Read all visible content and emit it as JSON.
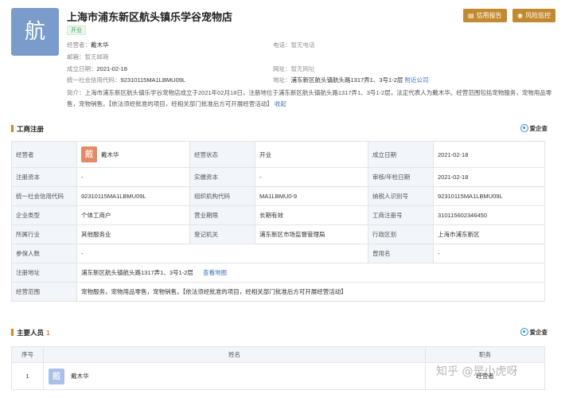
{
  "company": {
    "logo_char": "航",
    "name": "上海市浦东新区航头镇乐学谷宠物店",
    "status_tag": "开业"
  },
  "header_buttons": {
    "credit_report": "信用报告",
    "risk_monitor": "风险监控"
  },
  "info": {
    "operator_label": "经营者：",
    "operator_value": "戴木华",
    "phone_label": "电话：",
    "phone_value": "暂无电话",
    "email_label": "邮箱：",
    "email_value": "暂无邮箱",
    "founded_label": "成立日期：",
    "founded_value": "2021-02-18",
    "website_label": "网址：",
    "website_value": "暂无网址",
    "credit_code_label": "统一社会信用代码：",
    "credit_code_value": "92310115MA1LBMU09L",
    "address_label": "地址：",
    "address_value": "浦东新区航头镇航头路1317弄1、3号1-2层",
    "nearby_link": "附近公司",
    "intro_label": "简介：",
    "intro_text": "上海市浦东新区航头镇乐学谷宠物店成立于2021年02月18日，注册地位于浦东新区航头镇航头路1317弄1、3号1-2层，法定代表人为戴木华。经营范围包括宠物服务，宠物用品零售，宠物销售。【依法须经批准的项目，经相关部门批准后方可开展经营活动】",
    "collapse_link": "收起"
  },
  "registration": {
    "section_title": "工商注册",
    "qcc_label": "爱企查",
    "operator_avatar": "戴",
    "rows": [
      [
        {
          "k": "经营者",
          "v": "戴木华"
        },
        {
          "k": "经营状态",
          "v": "开业"
        },
        {
          "k": "成立日期",
          "v": "2021-02-18"
        }
      ],
      [
        {
          "k": "注册资本",
          "v": "-"
        },
        {
          "k": "实缴资本",
          "v": "-"
        },
        {
          "k": "审核/年检日期",
          "v": "2021-02-18"
        }
      ],
      [
        {
          "k": "统一社会信用代码",
          "v": "92310115MA1LBMU09L"
        },
        {
          "k": "组织机构代码",
          "v": "MA1LBMU0-9"
        },
        {
          "k": "纳税人识别号",
          "v": "92310115MA1LBMU09L"
        }
      ],
      [
        {
          "k": "企业类型",
          "v": "个体工商户"
        },
        {
          "k": "营业期限",
          "v": "长期有效"
        },
        {
          "k": "工商注册号",
          "v": "310115602346450"
        }
      ],
      [
        {
          "k": "所属行业",
          "v": "其他服务业"
        },
        {
          "k": "登记机关",
          "v": "浦东新区市场监督管理局"
        },
        {
          "k": "行政区划",
          "v": "上海市浦东新区"
        }
      ],
      [
        {
          "k": "参保人数",
          "v": "-"
        },
        {
          "k": "曾用名",
          "v": "-"
        }
      ]
    ],
    "address_key": "注册地址",
    "address_value": "浦东新区航头镇航头路1317弄1、3号1-2层",
    "map_link": "查看地图",
    "scope_key": "经营范围",
    "scope_value": "宠物服务，宠物用品零售，宠物销售。【依法须经批准的项目，经相关部门批准后方可开展经营活动】"
  },
  "staff": {
    "section_title": "主要人员",
    "count": "1",
    "qcc_label": "爱企查",
    "headers": {
      "index": "序号",
      "name": "姓名",
      "role": "职务"
    },
    "rows": [
      {
        "index": "1",
        "avatar": "戴",
        "name": "戴木华",
        "role": "经营者"
      }
    ]
  },
  "watermark": "知乎 @是小虎呀",
  "colors": {
    "accent": "#c3892f",
    "link": "#3f6fc0",
    "status_green": "#3da35a",
    "section_bar": "#d9832b",
    "table_key_bg": "#f2f5fa"
  }
}
